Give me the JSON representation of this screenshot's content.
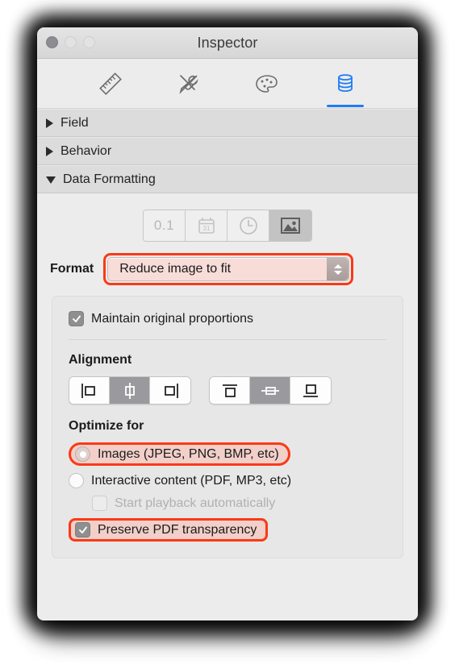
{
  "window": {
    "title": "Inspector",
    "traffic_lights": [
      {
        "name": "close",
        "label": "Close"
      },
      {
        "name": "minimize",
        "label": "Minimize"
      },
      {
        "name": "zoom",
        "label": "Zoom"
      }
    ]
  },
  "toolbar": {
    "tabs": [
      {
        "id": "position",
        "icon": "ruler-icon",
        "label": "Position",
        "selected": false
      },
      {
        "id": "appearance",
        "icon": "tools-icon",
        "label": "Appearance",
        "selected": false
      },
      {
        "id": "styles",
        "icon": "palette-icon",
        "label": "Styles",
        "selected": false
      },
      {
        "id": "data",
        "icon": "database-icon",
        "label": "Data",
        "selected": true
      }
    ],
    "accent_color": "#1f7df5"
  },
  "sections": [
    {
      "id": "field",
      "label": "Field",
      "expanded": false,
      "arrow": "triangle-right-icon"
    },
    {
      "id": "behavior",
      "label": "Behavior",
      "expanded": false,
      "arrow": "triangle-right-icon"
    },
    {
      "id": "data-formatting",
      "label": "Data Formatting",
      "expanded": true,
      "arrow": "triangle-down-icon"
    }
  ],
  "data_formatting": {
    "format_types": [
      {
        "id": "number",
        "icon": "number-icon",
        "label": "0.1",
        "selected": false
      },
      {
        "id": "date",
        "icon": "calendar-icon",
        "label": "31",
        "selected": false
      },
      {
        "id": "time",
        "icon": "clock-icon",
        "label": "Time",
        "selected": false
      },
      {
        "id": "image",
        "icon": "image-icon",
        "label": "Image",
        "selected": true
      }
    ],
    "format": {
      "label": "Format",
      "value": "Reduce image to fit",
      "highlighted": true,
      "stepper_icon": "chevron-updown-icon"
    },
    "maintain_proportions": {
      "label": "Maintain original proportions",
      "checked": true,
      "enabled": true
    },
    "alignment": {
      "title": "Alignment",
      "horizontal": [
        {
          "id": "left",
          "icon": "align-left-icon",
          "selected": false
        },
        {
          "id": "center",
          "icon": "align-center-icon",
          "selected": true
        },
        {
          "id": "right",
          "icon": "align-right-icon",
          "selected": false
        }
      ],
      "vertical": [
        {
          "id": "top",
          "icon": "align-top-icon",
          "selected": false
        },
        {
          "id": "middle",
          "icon": "align-middle-icon",
          "selected": true
        },
        {
          "id": "bottom",
          "icon": "align-bottom-icon",
          "selected": false
        }
      ]
    },
    "optimize_for": {
      "title": "Optimize for",
      "options": [
        {
          "id": "images",
          "label": "Images (JPEG, PNG, BMP, etc)",
          "selected": true,
          "highlighted": true
        },
        {
          "id": "interactive",
          "label": "Interactive content (PDF, MP3, etc)",
          "selected": false,
          "highlighted": false
        }
      ],
      "start_playback": {
        "label": "Start playback automatically",
        "checked": false,
        "enabled": false
      },
      "preserve_pdf_transparency": {
        "label": "Preserve PDF transparency",
        "checked": true,
        "enabled": true,
        "highlighted": true
      }
    }
  },
  "annotation": {
    "color": "#f93a16",
    "fill": "#f2cfc9"
  }
}
